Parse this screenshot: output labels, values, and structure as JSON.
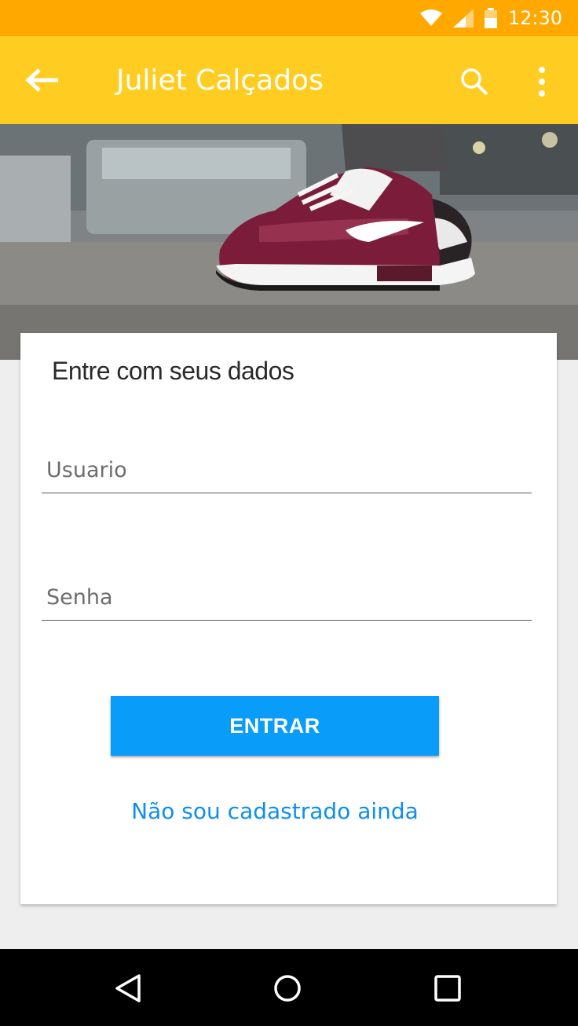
{
  "status_bar": {
    "time": "12:30"
  },
  "app_bar": {
    "title": "Juliet Calçados"
  },
  "hero": {
    "description_icon": "sneaker-image"
  },
  "login_card": {
    "title": "Entre com seus dados",
    "username_placeholder": "Usuario",
    "password_placeholder": "Senha",
    "submit_label": "ENTRAR",
    "register_link": "Não sou cadastrado ainda"
  },
  "colors": {
    "status_bar": "#ffa800",
    "app_bar": "#ffcd22",
    "primary_button": "#0a9cf9",
    "link": "#0d8ff0"
  }
}
